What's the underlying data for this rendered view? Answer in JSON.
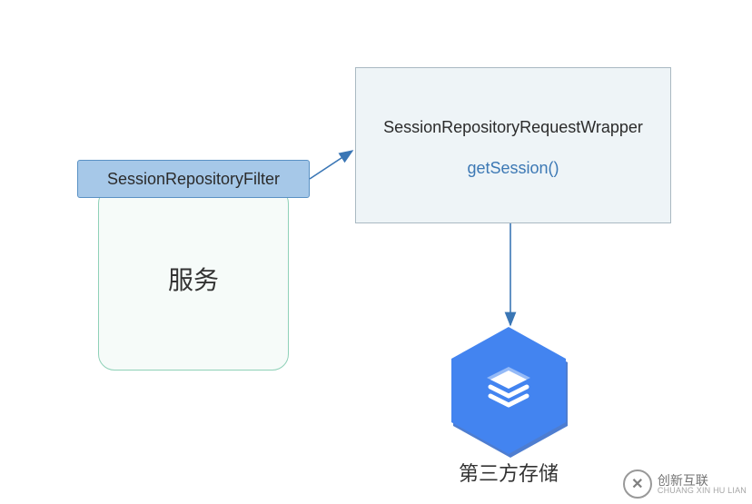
{
  "nodes": {
    "filter": {
      "label": "SessionRepositoryFilter"
    },
    "service": {
      "label": "服务"
    },
    "wrapper": {
      "title": "SessionRepositoryRequestWrapper",
      "method": "getSession()"
    },
    "storage": {
      "label": "第三方存储"
    }
  },
  "edges": [
    {
      "from": "filter",
      "to": "wrapper"
    },
    {
      "from": "wrapper",
      "to": "storage"
    }
  ],
  "watermark": {
    "cn": "创新互联",
    "en": "CHUANG XIN HU LIAN",
    "glyph": "✕"
  },
  "colors": {
    "arrow": "#3a76b5",
    "filterFill": "#a6c8e8",
    "filterBorder": "#5a91c4",
    "wrapperFill": "#eef4f7",
    "wrapperBorder": "#aab9c2",
    "serviceBorder": "#8fd1b8",
    "hex": "#4384f0",
    "link": "#3c78b4"
  }
}
